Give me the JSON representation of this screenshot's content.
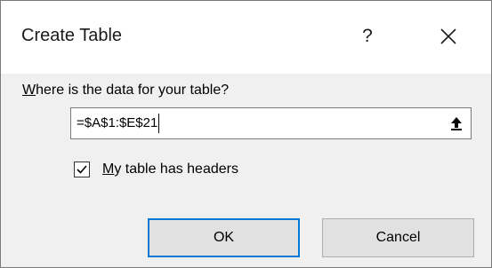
{
  "dialog": {
    "title": "Create Table",
    "help_label": "?",
    "close_icon": "close-icon"
  },
  "range": {
    "prompt_first": "W",
    "prompt_rest": "here is the data for your table?",
    "value": "=$A$1:$E$21",
    "collapse_icon": "collapse-dialog-icon"
  },
  "headers_option": {
    "checked": true,
    "label_first": "M",
    "label_rest": "y table has headers"
  },
  "buttons": {
    "ok": "OK",
    "cancel": "Cancel"
  },
  "colors": {
    "default_button_border": "#0078d7",
    "dialog_background": "#f0f0f0"
  }
}
